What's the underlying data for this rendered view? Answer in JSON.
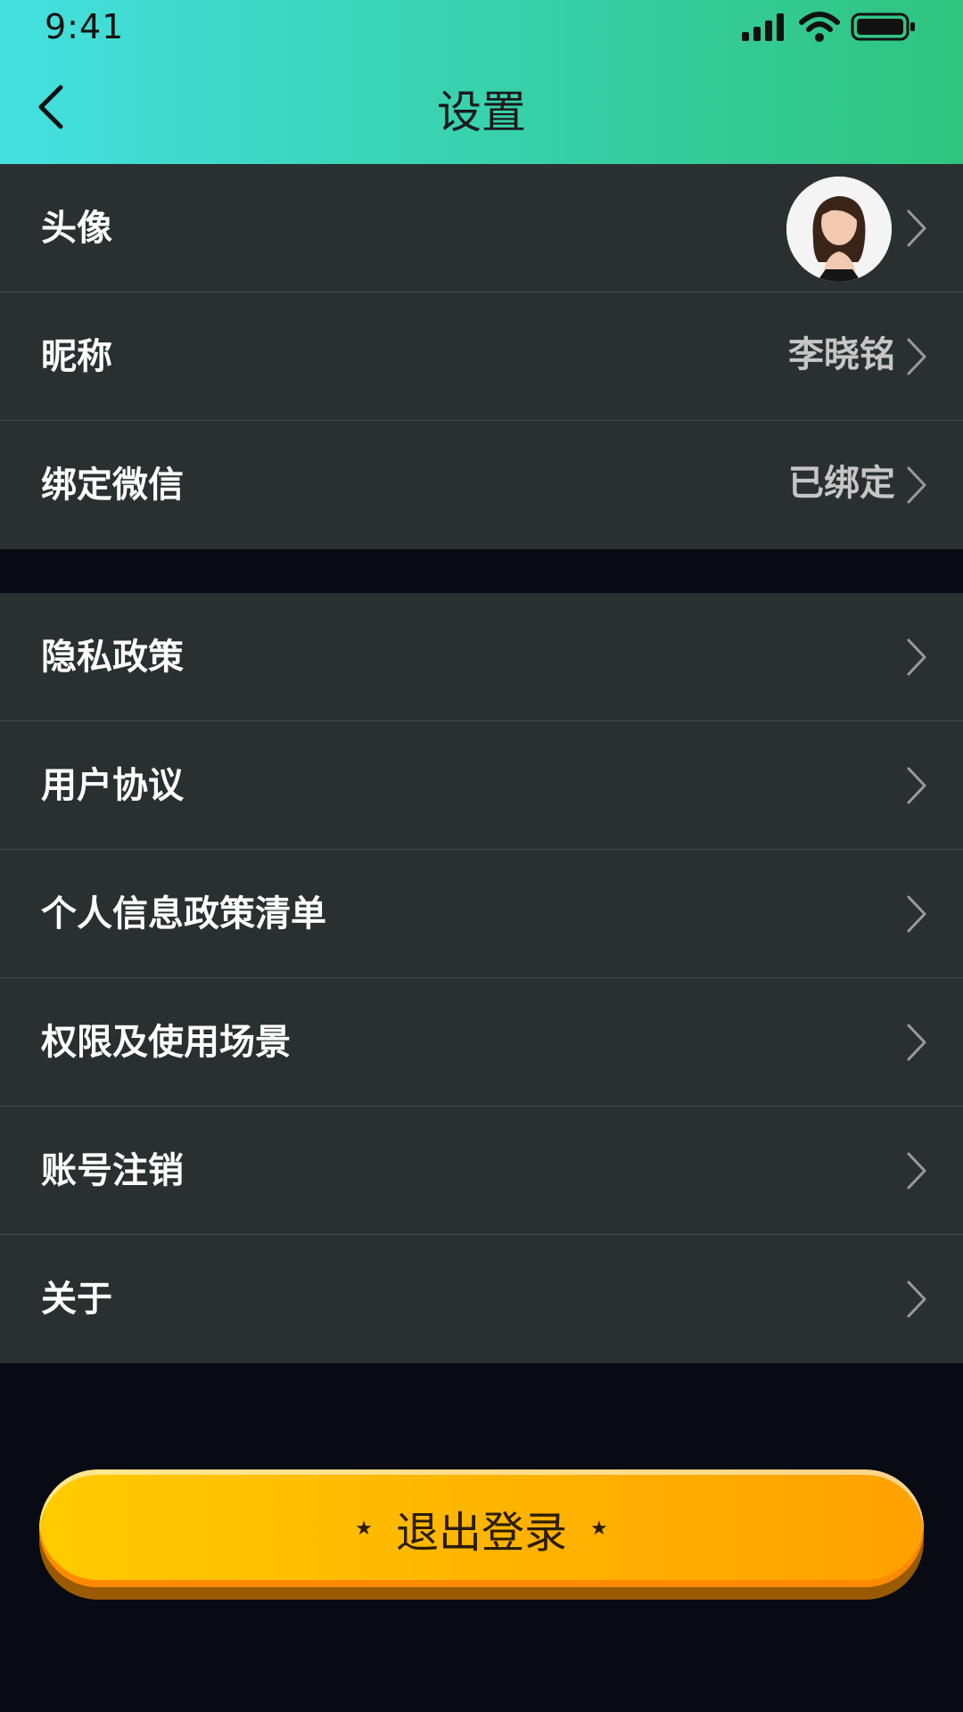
{
  "status_bar": {
    "time": "9:41"
  },
  "header": {
    "title": "设置",
    "back_icon": "chevron-left-icon"
  },
  "profile_group": [
    {
      "label": "头像",
      "value": "",
      "type": "avatar"
    },
    {
      "label": "昵称",
      "value": "李晓铭"
    },
    {
      "label": "绑定微信",
      "value": "已绑定"
    }
  ],
  "policy_group": [
    {
      "label": "隐私政策"
    },
    {
      "label": "用户协议"
    },
    {
      "label": "个人信息政策清单"
    },
    {
      "label": "权限及使用场景"
    },
    {
      "label": "账号注销"
    },
    {
      "label": "关于"
    }
  ],
  "logout": {
    "label": "退出登录",
    "star_left": "★",
    "star_right": "★"
  },
  "colors": {
    "header_gradient_start": "#44e0e0",
    "header_gradient_end": "#2fc47f",
    "row_background": "#2a2f30",
    "page_background": "#080b14",
    "logout_button": "#ffb300"
  }
}
